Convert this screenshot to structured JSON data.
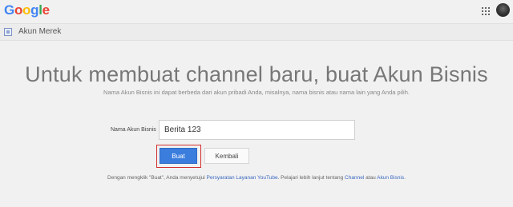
{
  "header": {
    "logo_letters": [
      {
        "char": "G",
        "color": "#4285F4"
      },
      {
        "char": "o",
        "color": "#EA4335"
      },
      {
        "char": "o",
        "color": "#FBBC05"
      },
      {
        "char": "g",
        "color": "#4285F4"
      },
      {
        "char": "l",
        "color": "#34A853"
      },
      {
        "char": "e",
        "color": "#EA4335"
      }
    ],
    "apps_icon": "apps-grid-icon",
    "avatar_icon": "user-avatar"
  },
  "brand_bar": {
    "icon": "brand-account-icon",
    "label": "Akun Merek"
  },
  "main": {
    "headline": "Untuk membuat channel baru, buat Akun Bisnis",
    "subtext": "Nama Akun Bisnis ini dapat berbeda dari akun pribadi Anda, misalnya, nama bisnis atau nama lain yang Anda pilih.",
    "field_label": "Nama Akun Bisnis",
    "field_value": "Berita 123",
    "create_button": "Buat",
    "back_button": "Kembali",
    "highlight_color": "#d32f2f",
    "accent_color": "#3b7ddd"
  },
  "terms": {
    "prefix": "Dengan mengklik \"Buat\", Anda menyetujui ",
    "tos_link": "Persyaratan Layanan YouTube",
    "middle": ". Pelajari lebih lanjut tentang ",
    "channel_link": "Channel",
    "or": " atau ",
    "business_link": "Akun Bisnis",
    "suffix": "."
  }
}
